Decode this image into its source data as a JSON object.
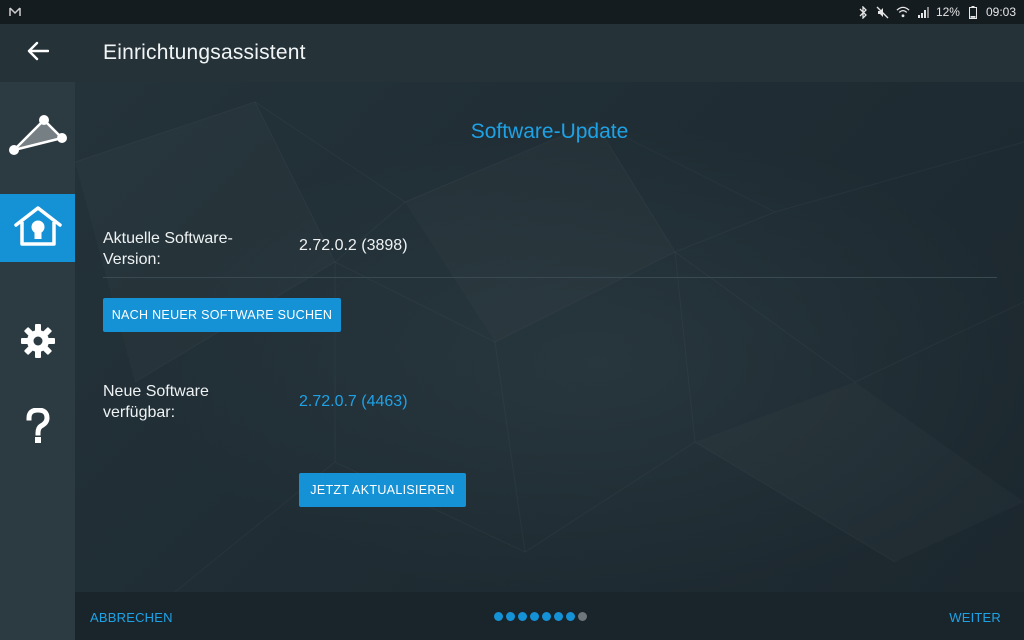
{
  "statusbar": {
    "battery": "12%",
    "time": "09:03",
    "icons": [
      "gmail-icon",
      "bluetooth-icon",
      "mute-icon",
      "wifi-icon",
      "signal-icon",
      "battery-icon"
    ]
  },
  "header": {
    "title": "Einrichtungsassistent",
    "back_icon": "arrow-left-icon"
  },
  "sidebar": {
    "items": [
      {
        "name": "network-icon",
        "active": false
      },
      {
        "name": "smart-home-icon",
        "active": true
      },
      {
        "name": "settings-icon",
        "active": false
      },
      {
        "name": "help-icon",
        "active": false
      }
    ]
  },
  "main": {
    "section_title": "Software-Update",
    "current_label": "Aktuelle Software-Version:",
    "current_value": "2.72.0.2 (3898)",
    "search_button": "NACH NEUER SOFTWARE SUCHEN",
    "new_label": "Neue Software verfügbar:",
    "new_value": "2.72.0.7 (4463)",
    "update_button": "JETZT AKTUALISIEREN"
  },
  "footer": {
    "cancel": "ABBRECHEN",
    "next": "WEITER",
    "progress": {
      "total": 8,
      "completed": 7
    }
  },
  "colors": {
    "accent": "#1591d5",
    "accent_text": "#1ea2e6",
    "background": "#1e2a31",
    "sidebar": "#2c3b42"
  }
}
